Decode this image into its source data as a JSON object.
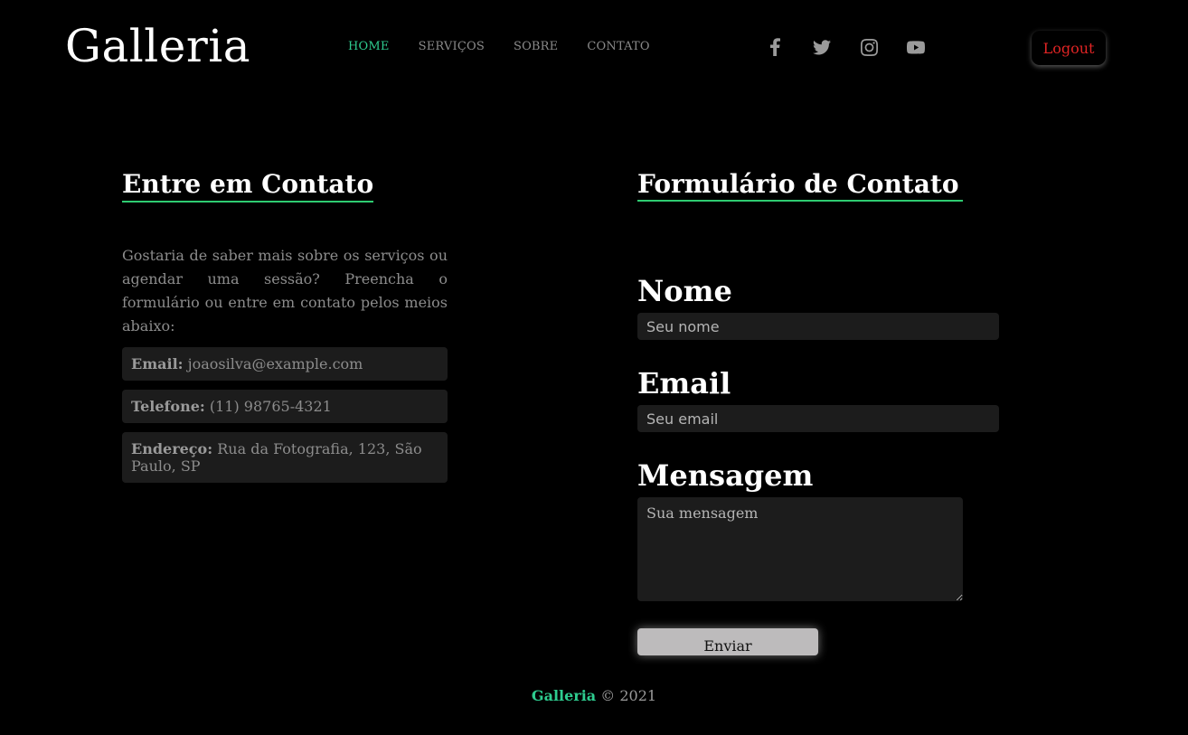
{
  "header": {
    "brand": "Galleria",
    "nav": [
      {
        "label": "HOME",
        "active": true
      },
      {
        "label": "SERVIÇOS",
        "active": false
      },
      {
        "label": "SOBRE",
        "active": false
      },
      {
        "label": "CONTATO",
        "active": false
      }
    ],
    "social_icons": [
      "facebook-icon",
      "twitter-icon",
      "instagram-icon",
      "youtube-icon"
    ],
    "logout_label": "Logout"
  },
  "contact_info": {
    "title": "Entre em Contato",
    "intro": "Gostaria de saber mais sobre os serviços ou agendar uma sessão? Preencha o formulário ou entre em contato pelos meios abaixo:",
    "email_label": "Email:",
    "email_value": "joaosilva@example.com",
    "phone_label": "Telefone:",
    "phone_value": "(11) 98765-4321",
    "address_label": "Endereço:",
    "address_value": "Rua da Fotografia, 123, São Paulo, SP"
  },
  "form": {
    "title": "Formulário de Contato",
    "name_label": "Nome",
    "name_placeholder": "Seu nome",
    "email_label": "Email",
    "email_placeholder": "Seu email",
    "message_label": "Mensagem",
    "message_placeholder": "Sua mensagem",
    "submit_label": "Enviar"
  },
  "footer": {
    "brand": "Galleria",
    "copyright": "© 2021"
  },
  "colors": {
    "accent": "#2ecc8f",
    "logout": "#e02424",
    "background": "#000000"
  }
}
